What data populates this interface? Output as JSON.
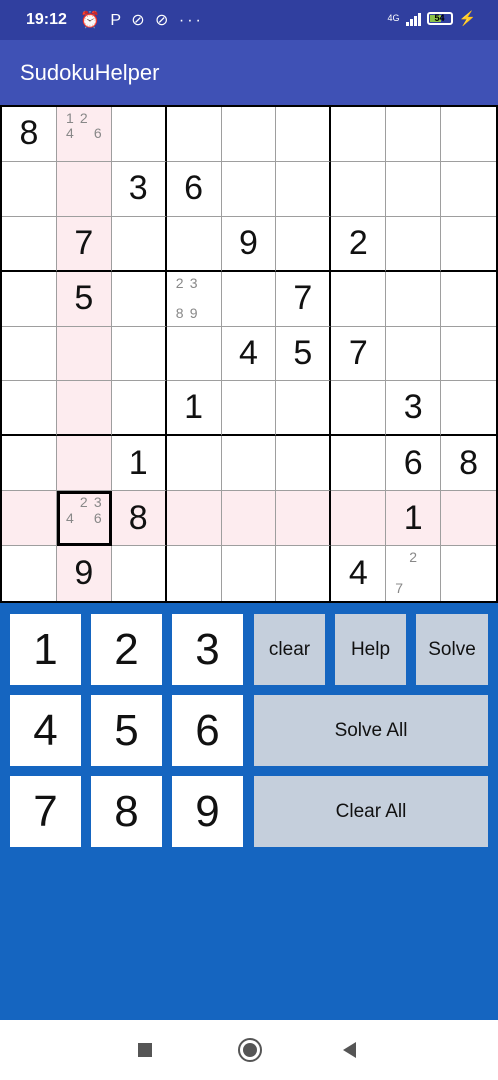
{
  "status_bar": {
    "time": "19:12",
    "left_icons": "⏰ P ⊘ ⊘ ···",
    "network": "4G",
    "battery": "54"
  },
  "app_bar": {
    "title": "SudokuHelper"
  },
  "board": {
    "givens": [
      [
        "8",
        "",
        "",
        "",
        "",
        "",
        "",
        "",
        ""
      ],
      [
        "",
        "",
        "3",
        "6",
        "",
        "",
        "",
        "",
        ""
      ],
      [
        "",
        "7",
        "",
        "",
        "9",
        "",
        "2",
        "",
        ""
      ],
      [
        "",
        "5",
        "",
        "",
        "",
        "7",
        "",
        "",
        ""
      ],
      [
        "",
        "",
        "",
        "",
        "4",
        "5",
        "7",
        "",
        ""
      ],
      [
        "",
        "",
        "",
        "1",
        "",
        "",
        "",
        "3",
        ""
      ],
      [
        "",
        "",
        "1",
        "",
        "",
        "",
        "",
        "6",
        "8"
      ],
      [
        "",
        "",
        "8",
        "",
        "",
        "",
        "",
        "1",
        ""
      ],
      [
        "",
        "9",
        "",
        "",
        "",
        "",
        "4",
        "",
        ""
      ]
    ],
    "candidates": {
      "0-1": [
        "1",
        "2",
        "",
        "4",
        "",
        "6",
        "",
        "",
        ""
      ],
      "3-3": [
        "2",
        "3",
        "",
        "",
        "",
        "",
        "8",
        "9",
        ""
      ],
      "7-1": [
        "",
        "2",
        "3",
        "4",
        "",
        "6",
        "",
        "",
        ""
      ],
      "8-7": [
        "",
        "2",
        "",
        "",
        "",
        "",
        "7",
        "",
        ""
      ]
    },
    "selected_cell": {
      "row": 8,
      "col": 2
    },
    "highlight_color": "#FDECEF"
  },
  "keypad": {
    "digits": [
      "1",
      "2",
      "3",
      "4",
      "5",
      "6",
      "7",
      "8",
      "9"
    ],
    "clear_label": "clear",
    "help_label": "Help",
    "solve_label": "Solve",
    "solve_all_label": "Solve All",
    "clear_all_label": "Clear All"
  },
  "colors": {
    "status_bar": "#303F9F",
    "app_bar": "#3F51B5",
    "background": "#1565C0",
    "function_key": "#C5CFDC"
  },
  "nav_bar": {
    "icons": [
      "recents-square-icon",
      "home-circle-icon",
      "back-triangle-icon"
    ]
  }
}
